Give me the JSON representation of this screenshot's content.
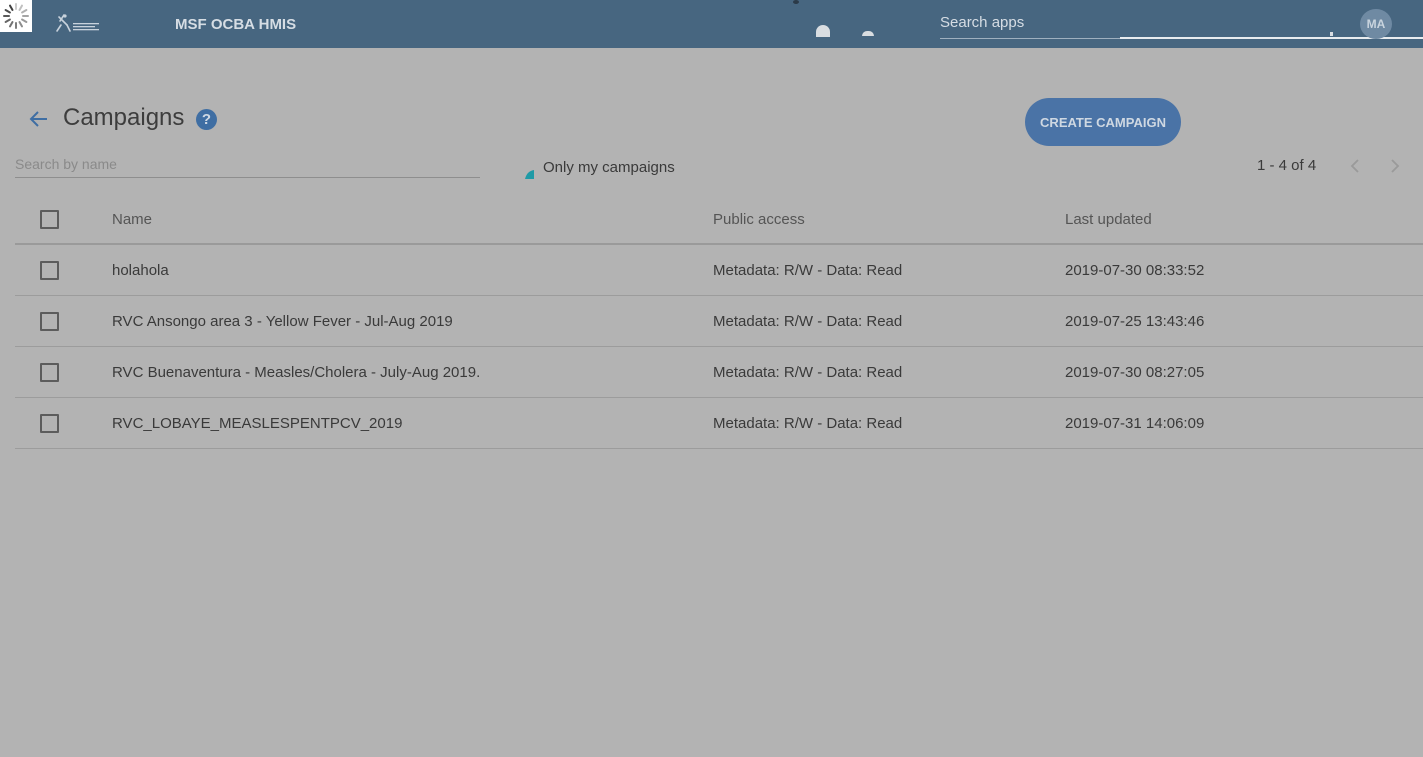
{
  "header": {
    "app_title": "MSF OCBA HMIS",
    "search_placeholder": "Search apps",
    "avatar_initials": "MA"
  },
  "page": {
    "title": "Campaigns",
    "help_icon": "help-circle-icon",
    "create_button_label": "CREATE CAMPAIGN"
  },
  "filters": {
    "search_placeholder": "Search by name",
    "only_mine_label": "Only my campaigns"
  },
  "pager": {
    "range_text": "1 - 4 of 4"
  },
  "table": {
    "columns": {
      "name": "Name",
      "access": "Public access",
      "updated": "Last updated"
    },
    "rows": [
      {
        "name": "holahola",
        "access": "Metadata: R/W - Data: Read",
        "updated": "2019-07-30 08:33:52"
      },
      {
        "name": "RVC Ansongo area 3 - Yellow Fever - Jul-Aug 2019",
        "access": "Metadata: R/W - Data: Read",
        "updated": "2019-07-25 13:43:46"
      },
      {
        "name": "RVC Buenaventura - Measles/Cholera - July-Aug 2019.",
        "access": "Metadata: R/W - Data: Read",
        "updated": "2019-07-30 08:27:05"
      },
      {
        "name": "RVC_LOBAYE_MEASLESPENTPCV_2019",
        "access": "Metadata: R/W - Data: Read",
        "updated": "2019-07-31 14:06:09"
      }
    ]
  },
  "colors": {
    "header_bg": "#476680",
    "overlay_bg": "#b3b3b3",
    "accent": "#4a73a6"
  }
}
